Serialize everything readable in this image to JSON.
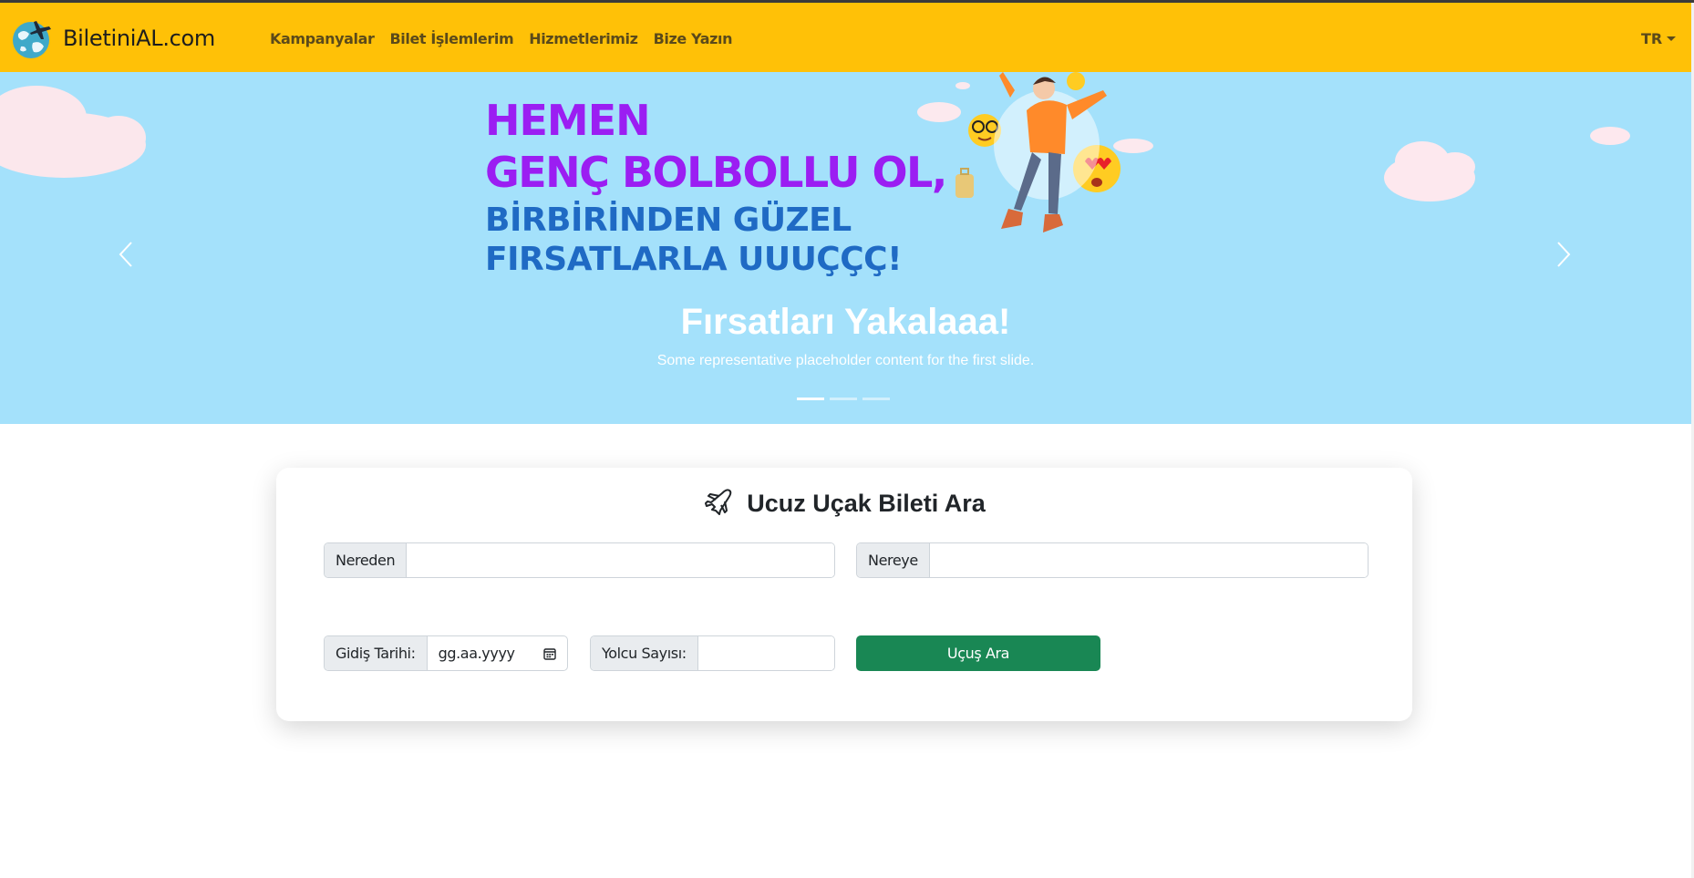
{
  "navbar": {
    "brand": "BiletiniAL.com",
    "links": [
      "Kampanyalar",
      "Bilet İşlemlerim",
      "Hizmetlerimiz",
      "Bize Yazın"
    ],
    "language": "TR"
  },
  "carousel": {
    "banner": {
      "line1": "HEMEN",
      "line2": "GENÇ BOLBOLLU OL,",
      "line3": "BİRBİRİNDEN GÜZEL",
      "line4": "FIRSATLARLA UUUÇÇÇ!"
    },
    "caption_title": "Fırsatları Yakalaaa!",
    "caption_text": "Some representative placeholder content for the first slide.",
    "slide_count": 3,
    "active_slide": 1
  },
  "search": {
    "title": "Ucuz Uçak Bileti Ara",
    "from_label": "Nereden",
    "from_value": "",
    "to_label": "Nereye",
    "to_value": "",
    "date_label": "Gidiş Tarihi:",
    "date_placeholder": "gg.aa.yyyy",
    "passenger_label": "Yolcu Sayısı:",
    "passenger_value": "",
    "submit_label": "Uçuş Ara"
  },
  "colors": {
    "navbar": "#ffc107",
    "banner_background": "#a4e1fb",
    "headline_purple": "#9b1ef2",
    "headline_blue": "#1f6ac4",
    "submit_button": "#198754"
  },
  "icons": [
    "globe-plane-logo-icon",
    "chevron-left-icon",
    "chevron-right-icon",
    "airplane-icon",
    "calendar-icon",
    "caret-down-icon"
  ]
}
